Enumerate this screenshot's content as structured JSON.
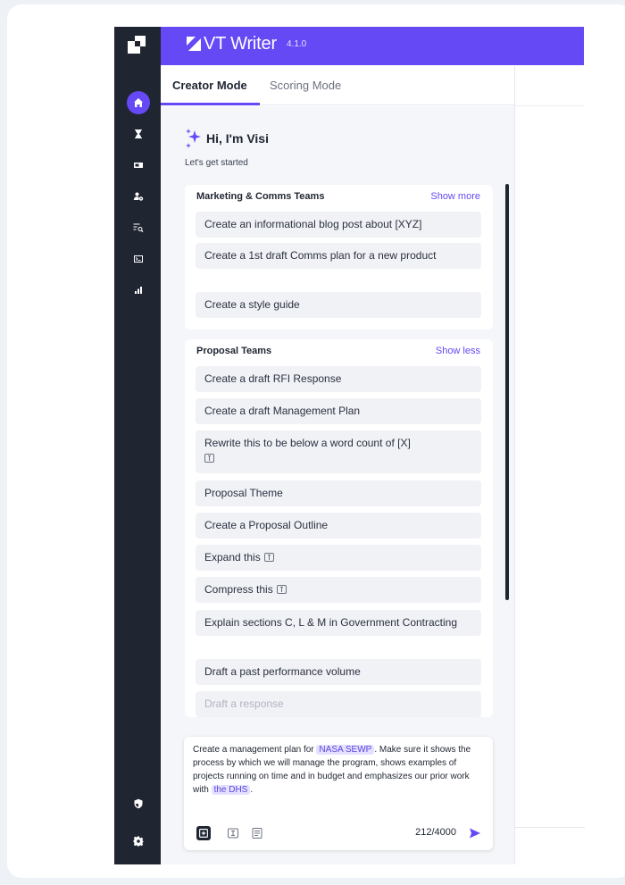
{
  "app": {
    "name": "VT Writer",
    "version": "4.1.0"
  },
  "tabs": [
    {
      "label": "Creator Mode",
      "active": true
    },
    {
      "label": "Scoring Mode",
      "active": false
    }
  ],
  "greeting": {
    "title": "Hi, I'm Visi",
    "subtitle": "Let's get started"
  },
  "groups": [
    {
      "title": "Marketing & Comms Teams",
      "link": "Show more",
      "items": [
        {
          "label": "Create an informational blog post about [XYZ]"
        },
        {
          "label": "Create a 1st draft Comms plan for a new product"
        },
        {
          "label": "Create a style guide"
        }
      ]
    },
    {
      "title": "Proposal Teams",
      "link": "Show less",
      "items": [
        {
          "label": "Create a draft RFI Response"
        },
        {
          "label": "Create a draft Management Plan"
        },
        {
          "label": "Rewrite this to be below a word count of [X]",
          "icon": "text-cursor-icon"
        },
        {
          "label": "Proposal Theme"
        },
        {
          "label": "Create a Proposal Outline"
        },
        {
          "label": "Expand this",
          "icon": "text-cursor-icon"
        },
        {
          "label": "Compress this",
          "icon": "text-cursor-icon"
        },
        {
          "label": "Explain sections C, L & M in Government Contracting"
        },
        {
          "label": "Draft a past performance volume"
        },
        {
          "label": "Draft a response"
        }
      ]
    }
  ],
  "composer": {
    "text_before": "Create a management plan for ",
    "tag1": "NASA SEWP",
    "text_middle": ". Make sure it shows the process by which we will manage the program, shows examples of projects running on time and in budget and emphasizes our prior work with ",
    "tag2": "the DHS",
    "text_after": ".",
    "counter": "212/4000"
  },
  "colors": {
    "accent": "#6549f5",
    "rail": "#1f2531",
    "panel": "#f5f6f9"
  },
  "rail_icons": [
    "home-icon",
    "hourglass-icon",
    "card-icon",
    "user-settings-icon",
    "list-search-icon",
    "terminal-icon",
    "bar-chart-icon",
    "shield-icon",
    "gear-icon"
  ]
}
